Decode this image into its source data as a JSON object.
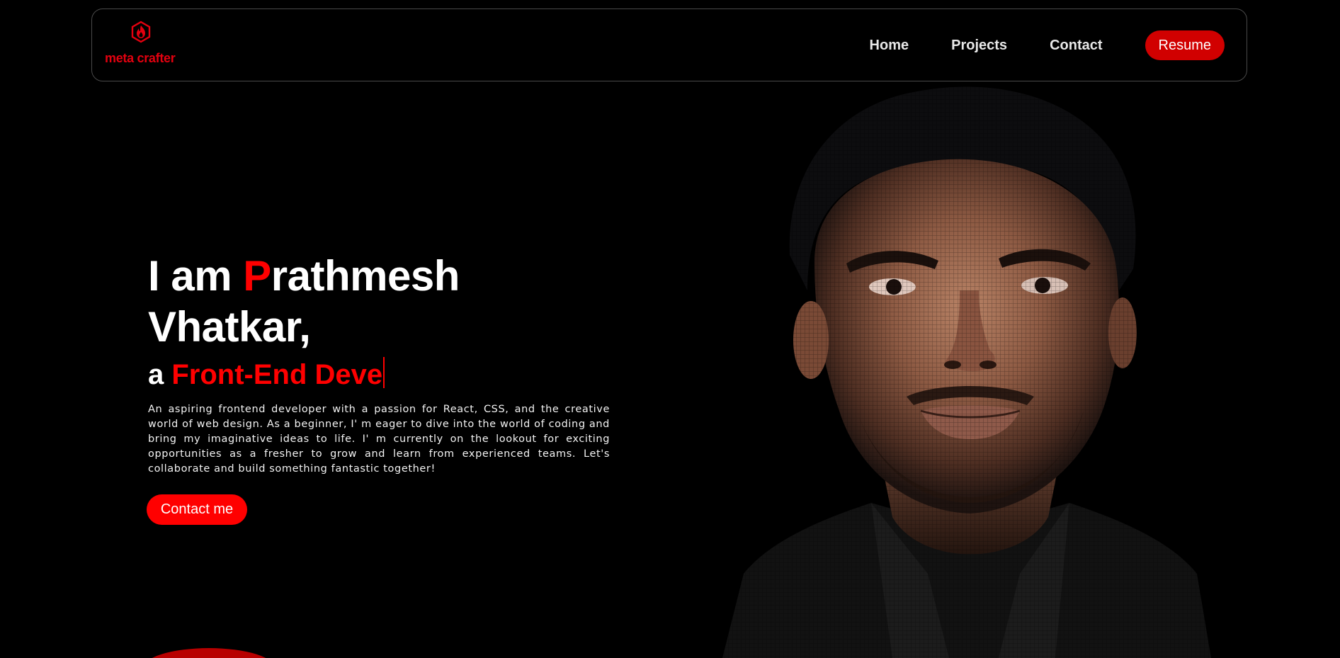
{
  "brand": {
    "logo_text": "meta crafter",
    "logo_icon": "flame-hexagon-icon",
    "accent_color": "#ff0000"
  },
  "nav": {
    "links": [
      "Home",
      "Projects",
      "Contact"
    ],
    "resume_label": "Resume"
  },
  "hero": {
    "line1_prefix": "I am ",
    "line1_accent": "P",
    "line1_rest": "rathmesh",
    "line2": "Vhatkar,",
    "role_prefix": "a ",
    "role_typed": "Front-End Deve",
    "description": "An aspiring frontend developer with a passion for React, CSS, and the creative world of web design. As a beginner, I' m eager to dive into the world of coding and bring my imaginative ideas to life. I' m currently on the lookout for exciting opportunities as a fresher to grow and learn from experienced teams. Let's collaborate and build something fantastic together!",
    "cta_label": "Contact me"
  }
}
